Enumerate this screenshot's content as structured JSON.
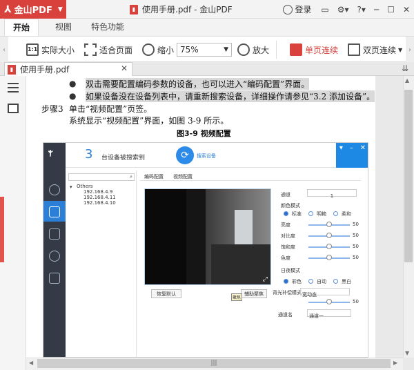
{
  "app": {
    "brand": "金山PDF",
    "doc_title": "使用手册.pdf - 金山PDF",
    "login": "登录"
  },
  "tabs": [
    "开始",
    "视图",
    "特色功能"
  ],
  "toolbar": {
    "actual_size": "实际大小",
    "actual_size_icon": "1:1",
    "fit_page": "适合页面",
    "zoom_out": "缩小",
    "zoom_value": "75%",
    "zoom_in": "放大",
    "single_page": "单页连续",
    "double_page": "双页连续"
  },
  "doc_tab": {
    "label": "使用手册.pdf"
  },
  "page": {
    "bullet1": "双击需要配置编码参数的设备，也可以进入“编码配置”界面。",
    "bullet2": "如果设备没在设备列表中，请重新搜索设备，详细操作请参见“3.2 添加设备”。",
    "step_label": "步骤3",
    "step_text": "单击“视频配置”页签。",
    "step_result": "系统显示“视频配置”界面，如图 3-9 所示。",
    "figure_caption": "图3-9  视频配置"
  },
  "shot": {
    "count": "3",
    "found_text": "台设备被搜索到",
    "search_btn": "搜索设备",
    "tree_root": "Others",
    "devices": [
      "192.168.4.9",
      "192.168.4.11",
      "192.168.4.10"
    ],
    "tab_encode": "编码配置",
    "tab_video": "视频配置",
    "channel_label": "通道",
    "channel_value": "1",
    "color_mode_label": "颜色模式",
    "color_modes": [
      "标准",
      "明艳",
      "柔和"
    ],
    "sliders": [
      {
        "label": "亮度",
        "value": "50"
      },
      {
        "label": "对比度",
        "value": "50"
      },
      {
        "label": "饱和度",
        "value": "50"
      },
      {
        "label": "色度",
        "value": "50"
      }
    ],
    "day_night_label": "日夜模式",
    "day_night": [
      "彩色",
      "自动",
      "黑白"
    ],
    "backlight_label": "背光补偿模式",
    "backlight_value": "宽动态",
    "backlight_slider_value": "50",
    "channel_name_label": "通道名",
    "channel_name_value": "通道一",
    "restore_btn": "恢复默认",
    "aux_btn": "辅助聚焦",
    "tooltip": "聚焦"
  }
}
